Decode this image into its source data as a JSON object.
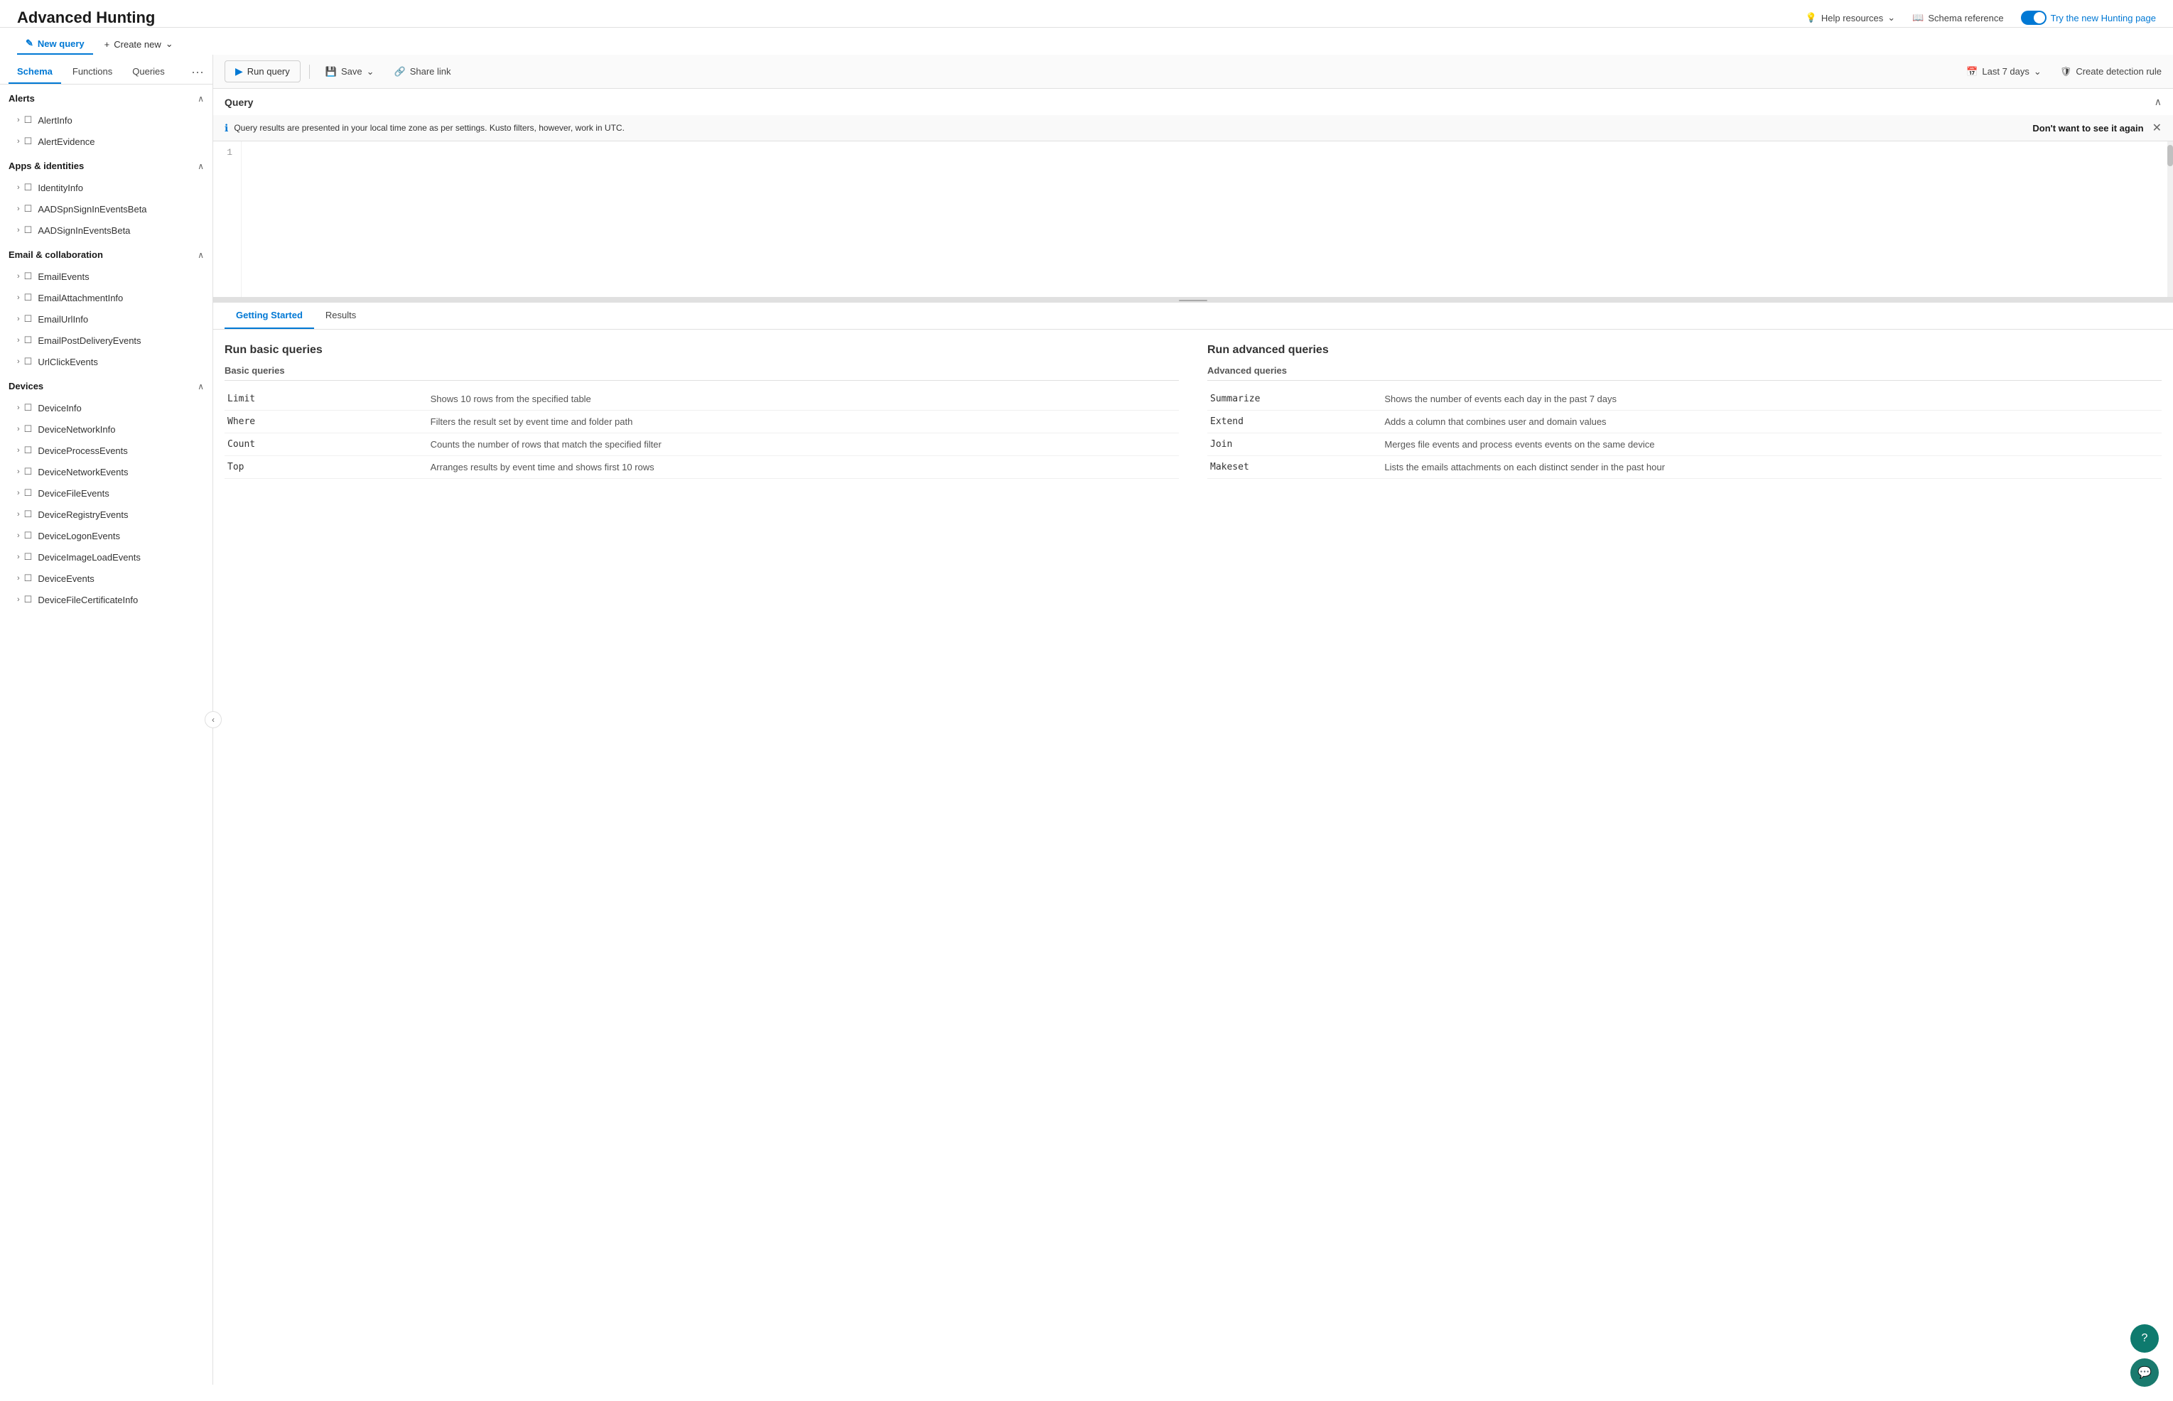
{
  "page": {
    "title": "Advanced Hunting"
  },
  "header": {
    "help_resources": "Help resources",
    "schema_reference": "Schema reference",
    "try_new_label": "Try the new Hunting page"
  },
  "toolbar": {
    "new_query": "New query",
    "create_new": "Create new"
  },
  "sidebar": {
    "tabs": [
      {
        "id": "schema",
        "label": "Schema",
        "active": true
      },
      {
        "id": "functions",
        "label": "Functions",
        "active": false
      },
      {
        "id": "queries",
        "label": "Queries",
        "active": false
      }
    ],
    "sections": [
      {
        "id": "alerts",
        "title": "Alerts",
        "expanded": true,
        "items": [
          {
            "name": "AlertInfo"
          },
          {
            "name": "AlertEvidence"
          }
        ]
      },
      {
        "id": "apps-identities",
        "title": "Apps & identities",
        "expanded": true,
        "items": [
          {
            "name": "IdentityInfo"
          },
          {
            "name": "AADSpnSignInEventsBeta"
          },
          {
            "name": "AADSignInEventsBeta"
          }
        ]
      },
      {
        "id": "email-collaboration",
        "title": "Email & collaboration",
        "expanded": true,
        "items": [
          {
            "name": "EmailEvents"
          },
          {
            "name": "EmailAttachmentInfo"
          },
          {
            "name": "EmailUrlInfo"
          },
          {
            "name": "EmailPostDeliveryEvents"
          },
          {
            "name": "UrlClickEvents"
          }
        ]
      },
      {
        "id": "devices",
        "title": "Devices",
        "expanded": true,
        "items": [
          {
            "name": "DeviceInfo"
          },
          {
            "name": "DeviceNetworkInfo"
          },
          {
            "name": "DeviceProcessEvents"
          },
          {
            "name": "DeviceNetworkEvents"
          },
          {
            "name": "DeviceFileEvents"
          },
          {
            "name": "DeviceRegistryEvents"
          },
          {
            "name": "DeviceLogonEvents"
          },
          {
            "name": "DeviceImageLoadEvents"
          },
          {
            "name": "DeviceEvents"
          },
          {
            "name": "DeviceFileCertificateInfo"
          }
        ]
      }
    ]
  },
  "query_toolbar": {
    "run_query": "Run query",
    "save": "Save",
    "share_link": "Share link",
    "last_days": "Last 7 days",
    "create_detection": "Create detection rule"
  },
  "query_section": {
    "title": "Query",
    "line_number": "1"
  },
  "info_banner": {
    "message": "Query results are presented in your local time zone as per settings. Kusto filters, however, work in UTC.",
    "dismiss": "Don't want to see it again"
  },
  "results_tabs": [
    {
      "id": "getting-started",
      "label": "Getting Started",
      "active": true
    },
    {
      "id": "results",
      "label": "Results",
      "active": false
    }
  ],
  "getting_started": {
    "basic_title": "Run basic queries",
    "advanced_title": "Run advanced queries",
    "basic_subtitle": "Basic queries",
    "advanced_subtitle": "Advanced queries",
    "basic_rows": [
      {
        "keyword": "Limit",
        "description": "Shows 10 rows from the specified table"
      },
      {
        "keyword": "Where",
        "description": "Filters the result set by event time and folder path"
      },
      {
        "keyword": "Count",
        "description": "Counts the number of rows that match the specified filter"
      },
      {
        "keyword": "Top",
        "description": "Arranges results by event time and shows first 10 rows"
      }
    ],
    "advanced_rows": [
      {
        "keyword": "Summarize",
        "description": "Shows the number of events each day in the past 7 days"
      },
      {
        "keyword": "Extend",
        "description": "Adds a column that combines user and domain values"
      },
      {
        "keyword": "Join",
        "description": "Merges file events and process events events on the same device"
      },
      {
        "keyword": "Makeset",
        "description": "Lists the emails attachments on each distinct sender in the past hour"
      }
    ]
  }
}
